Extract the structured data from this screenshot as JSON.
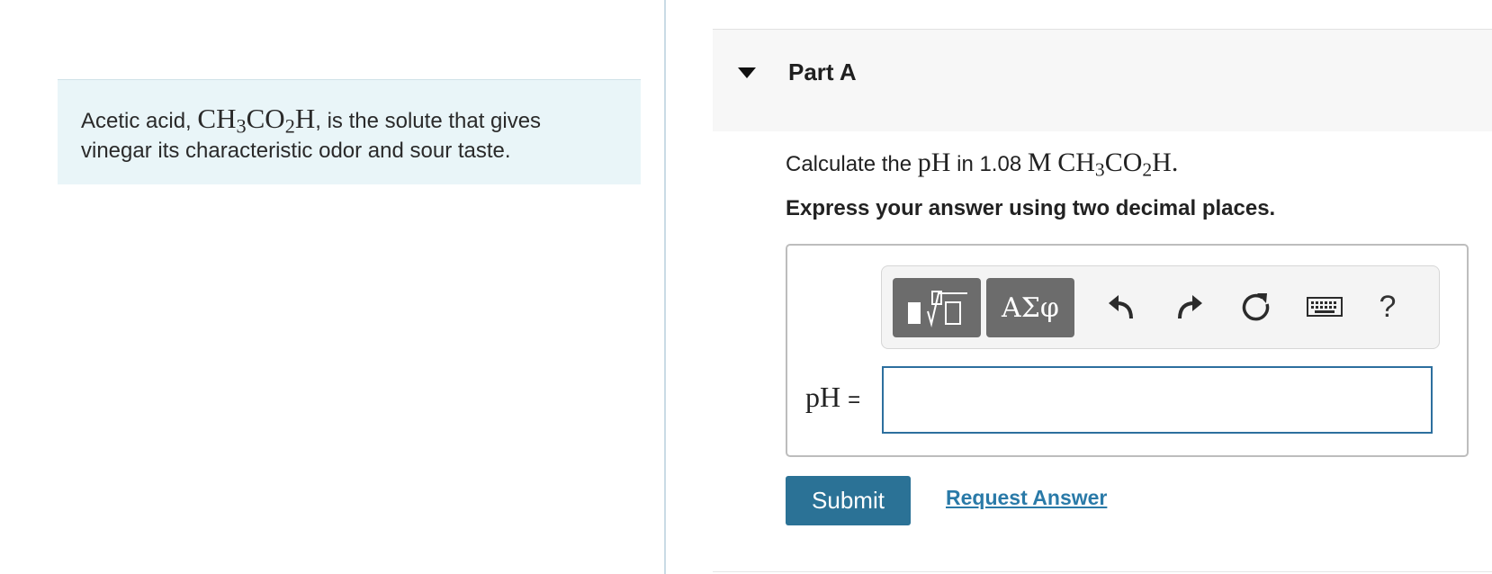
{
  "intro": {
    "prefix": "Acetic acid, ",
    "formula": {
      "a": "CH",
      "b": "3",
      "c": "CO",
      "d": "2",
      "e": "H"
    },
    "suffix": ", is the solute that gives vinegar its characteristic odor and sour taste."
  },
  "part": {
    "title": "Part A",
    "question_prefix": "Calculate the ",
    "question_ph": "pH",
    "question_mid": " in 1.08 ",
    "question_unit": "M",
    "question_formula": {
      "a": "CH",
      "b": "3",
      "c": "CO",
      "d": "2",
      "e": "H"
    },
    "question_end": ".",
    "instruction": "Express your answer using two decimal places."
  },
  "toolbar": {
    "templates_icon": "sqrt-template-icon",
    "greek_label": "ΑΣφ",
    "undo_icon": "undo-icon",
    "redo_icon": "redo-icon",
    "reset_icon": "reset-icon",
    "keyboard_icon": "keyboard-icon",
    "help_label": "?"
  },
  "answer": {
    "label": "pH",
    "equals": "=",
    "value": ""
  },
  "actions": {
    "submit_label": "Submit",
    "request_label": "Request Answer"
  },
  "colors": {
    "intro_bg": "#e9f5f8",
    "submit_bg": "#2b7296",
    "link": "#2a7aa8",
    "input_border": "#2d6f9e"
  }
}
